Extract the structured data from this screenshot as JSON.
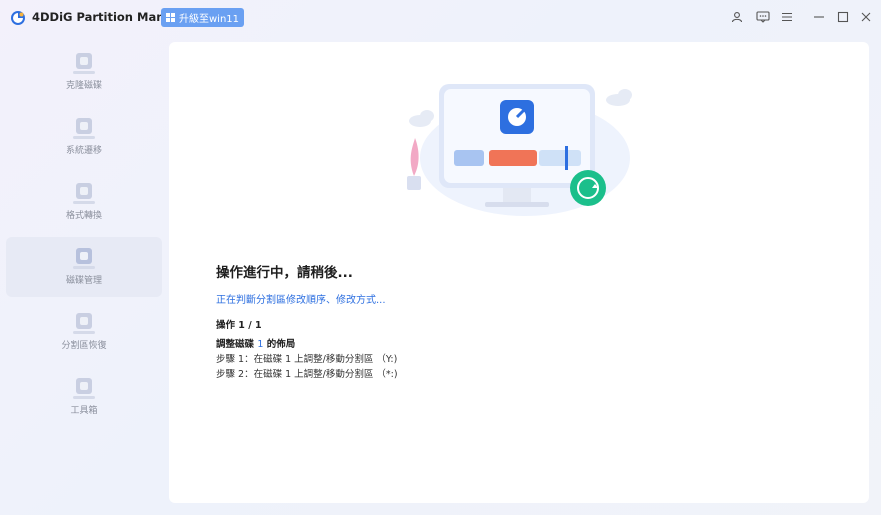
{
  "app": {
    "title": "4DDiG Partition Manager",
    "upgrade_label": "升級至win11",
    "accent": "#6aa0f2"
  },
  "titlebar_icons": [
    "user-icon",
    "feedback-icon",
    "menu-icon",
    "minimize-icon",
    "maximize-icon",
    "close-icon"
  ],
  "sidebar": {
    "items": [
      {
        "label": "克隆磁碟",
        "icon": "clone-icon"
      },
      {
        "label": "系統遷移",
        "icon": "system-migrate-icon"
      },
      {
        "label": "格式轉換",
        "icon": "format-convert-icon"
      },
      {
        "label": "磁碟管理",
        "icon": "disk-manage-icon",
        "active": true
      },
      {
        "label": "分割區恢復",
        "icon": "partition-recover-icon"
      },
      {
        "label": "工具箱",
        "icon": "toolbox-icon"
      }
    ]
  },
  "main": {
    "title": "操作進行中，請稍後...",
    "status": "正在判斷分割區修改順序、修改方式...",
    "operation_count": "操作 1 / 1",
    "heading_prefix": "調整磁碟",
    "heading_disk": "1",
    "heading_suffix": "的佈局",
    "steps": [
      "步驟 1：在磁碟 1 上調整/移動分割區 （Y:)",
      "步驟 2：在磁碟 1 上調整/移動分割區 （*:)"
    ],
    "status_color": "#2d6fe0"
  }
}
